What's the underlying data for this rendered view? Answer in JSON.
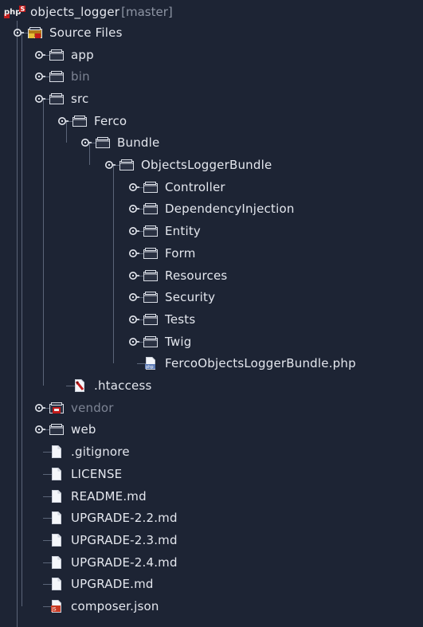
{
  "project": {
    "name": "objects_logger",
    "branch": "[master]",
    "icon": "php-project-icon"
  },
  "tree": [
    {
      "label": "Source Files",
      "icon": "source-folder-icon",
      "dim": false
    },
    {
      "label": "app",
      "icon": "folder-icon",
      "dim": false
    },
    {
      "label": "bin",
      "icon": "folder-icon",
      "dim": true
    },
    {
      "label": "src",
      "icon": "folder-icon",
      "dim": false
    },
    {
      "label": "Ferco",
      "icon": "folder-icon",
      "dim": false
    },
    {
      "label": "Bundle",
      "icon": "folder-icon",
      "dim": false
    },
    {
      "label": "ObjectsLoggerBundle",
      "icon": "folder-icon",
      "dim": false
    },
    {
      "label": "Controller",
      "icon": "folder-icon",
      "dim": false
    },
    {
      "label": "DependencyInjection",
      "icon": "folder-icon",
      "dim": false
    },
    {
      "label": "Entity",
      "icon": "folder-icon",
      "dim": false
    },
    {
      "label": "Form",
      "icon": "folder-icon",
      "dim": false
    },
    {
      "label": "Resources",
      "icon": "folder-icon",
      "dim": false
    },
    {
      "label": "Security",
      "icon": "folder-icon",
      "dim": false
    },
    {
      "label": "Tests",
      "icon": "folder-icon",
      "dim": false
    },
    {
      "label": "Twig",
      "icon": "folder-icon",
      "dim": false
    },
    {
      "label": "FercoObjectsLoggerBundle.php",
      "icon": "php-file-icon",
      "dim": false
    },
    {
      "label": ".htaccess",
      "icon": "htaccess-file-icon",
      "dim": false
    },
    {
      "label": "vendor",
      "icon": "vendor-folder-icon",
      "dim": true
    },
    {
      "label": "web",
      "icon": "folder-icon",
      "dim": false
    },
    {
      "label": ".gitignore",
      "icon": "file-icon",
      "dim": false
    },
    {
      "label": "LICENSE",
      "icon": "file-icon",
      "dim": false
    },
    {
      "label": "README.md",
      "icon": "file-icon",
      "dim": false
    },
    {
      "label": "UPGRADE-2.2.md",
      "icon": "file-icon",
      "dim": false
    },
    {
      "label": "UPGRADE-2.3.md",
      "icon": "file-icon",
      "dim": false
    },
    {
      "label": "UPGRADE-2.4.md",
      "icon": "file-icon",
      "dim": false
    },
    {
      "label": "UPGRADE.md",
      "icon": "file-icon",
      "dim": false
    },
    {
      "label": "composer.json",
      "icon": "json-file-icon",
      "dim": false
    }
  ]
}
